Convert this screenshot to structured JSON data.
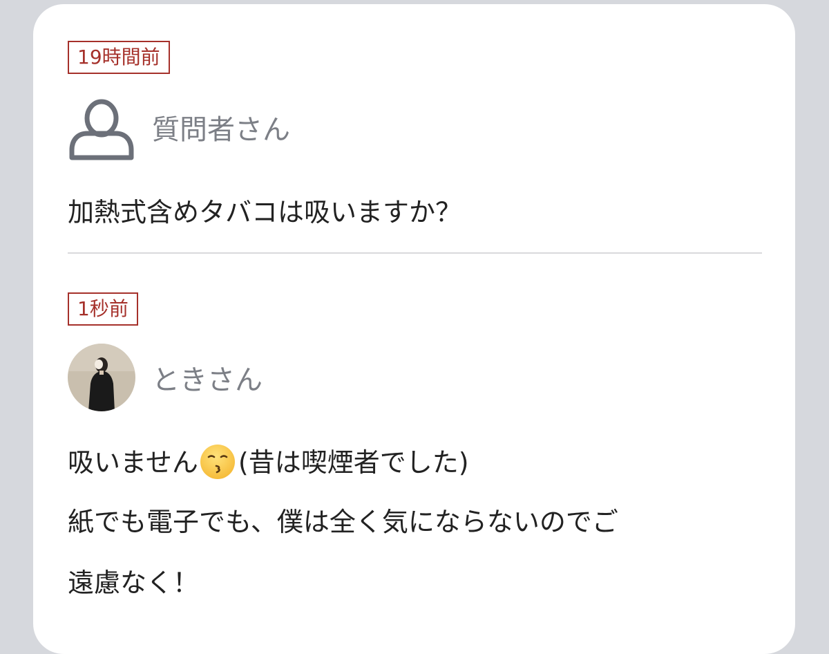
{
  "question": {
    "time": "19時間前",
    "user_name": "質問者さん",
    "user_icon": "user-outline-icon",
    "text": "加熱式含めタバコは吸いますか？"
  },
  "answer": {
    "time": "1秒前",
    "user_name": "ときさん",
    "line1_prefix": "吸いません",
    "line1_emoji": "kissing-face-with-closed-eyes-emoji",
    "line1_suffix": "(昔は喫煙者でした)",
    "line2": "紙でも電子でも、僕は全く気にならないのでご",
    "line3": "遠慮なく！"
  },
  "colors": {
    "badge": "#a5302a",
    "name": "#7c7f86",
    "text": "#222222",
    "background": "#d6d8dd",
    "card": "#ffffff"
  }
}
